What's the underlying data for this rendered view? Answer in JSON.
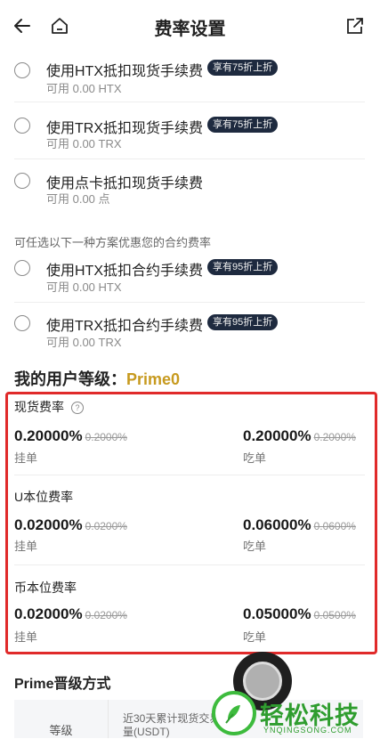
{
  "header": {
    "title": "费率设置"
  },
  "spot_options": [
    {
      "label": "使用HTX抵扣现货手续费",
      "badge": "享有75折上折",
      "available": "可用 0.00 HTX"
    },
    {
      "label": "使用TRX抵扣现货手续费",
      "badge": "享有75折上折",
      "available": "可用 0.00 TRX"
    },
    {
      "label": "使用点卡抵扣现货手续费",
      "badge": "",
      "available": "可用 0.00 点"
    }
  ],
  "contract_hint": "可任选以下一种方案优惠您的合约费率",
  "contract_options": [
    {
      "label": "使用HTX抵扣合约手续费",
      "badge": "享有95折上折",
      "available": "可用 0.00 HTX"
    },
    {
      "label": "使用TRX抵扣合约手续费",
      "badge": "享有95折上折",
      "available": "可用 0.00 TRX"
    }
  ],
  "user_level": {
    "label": "我的用户等级：",
    "value": "Prime0"
  },
  "fee_sections": [
    {
      "title": "现货费率",
      "maker_rate": "0.20000%",
      "maker_old": "0.2000%",
      "maker_label": "挂单",
      "taker_rate": "0.20000%",
      "taker_old": "0.2000%",
      "taker_label": "吃单"
    },
    {
      "title": "U本位费率",
      "maker_rate": "0.02000%",
      "maker_old": "0.0200%",
      "maker_label": "挂单",
      "taker_rate": "0.06000%",
      "taker_old": "0.0600%",
      "taker_label": "吃单"
    },
    {
      "title": "币本位费率",
      "maker_rate": "0.02000%",
      "maker_old": "0.0200%",
      "maker_label": "挂单",
      "taker_rate": "0.05000%",
      "taker_old": "0.0500%",
      "taker_label": "吃单"
    }
  ],
  "prime": {
    "title": "Prime晋级方式",
    "col_level": "等级",
    "col_volume": "近30天累计现货交易量(USDT)"
  },
  "watermark": {
    "brand": "轻松科技",
    "domain": "YNQINGSONG.COM"
  },
  "colors": {
    "accent_gold": "#c79a1f",
    "highlight_red": "#e02a2a",
    "badge_bg": "#1e2a3f"
  }
}
